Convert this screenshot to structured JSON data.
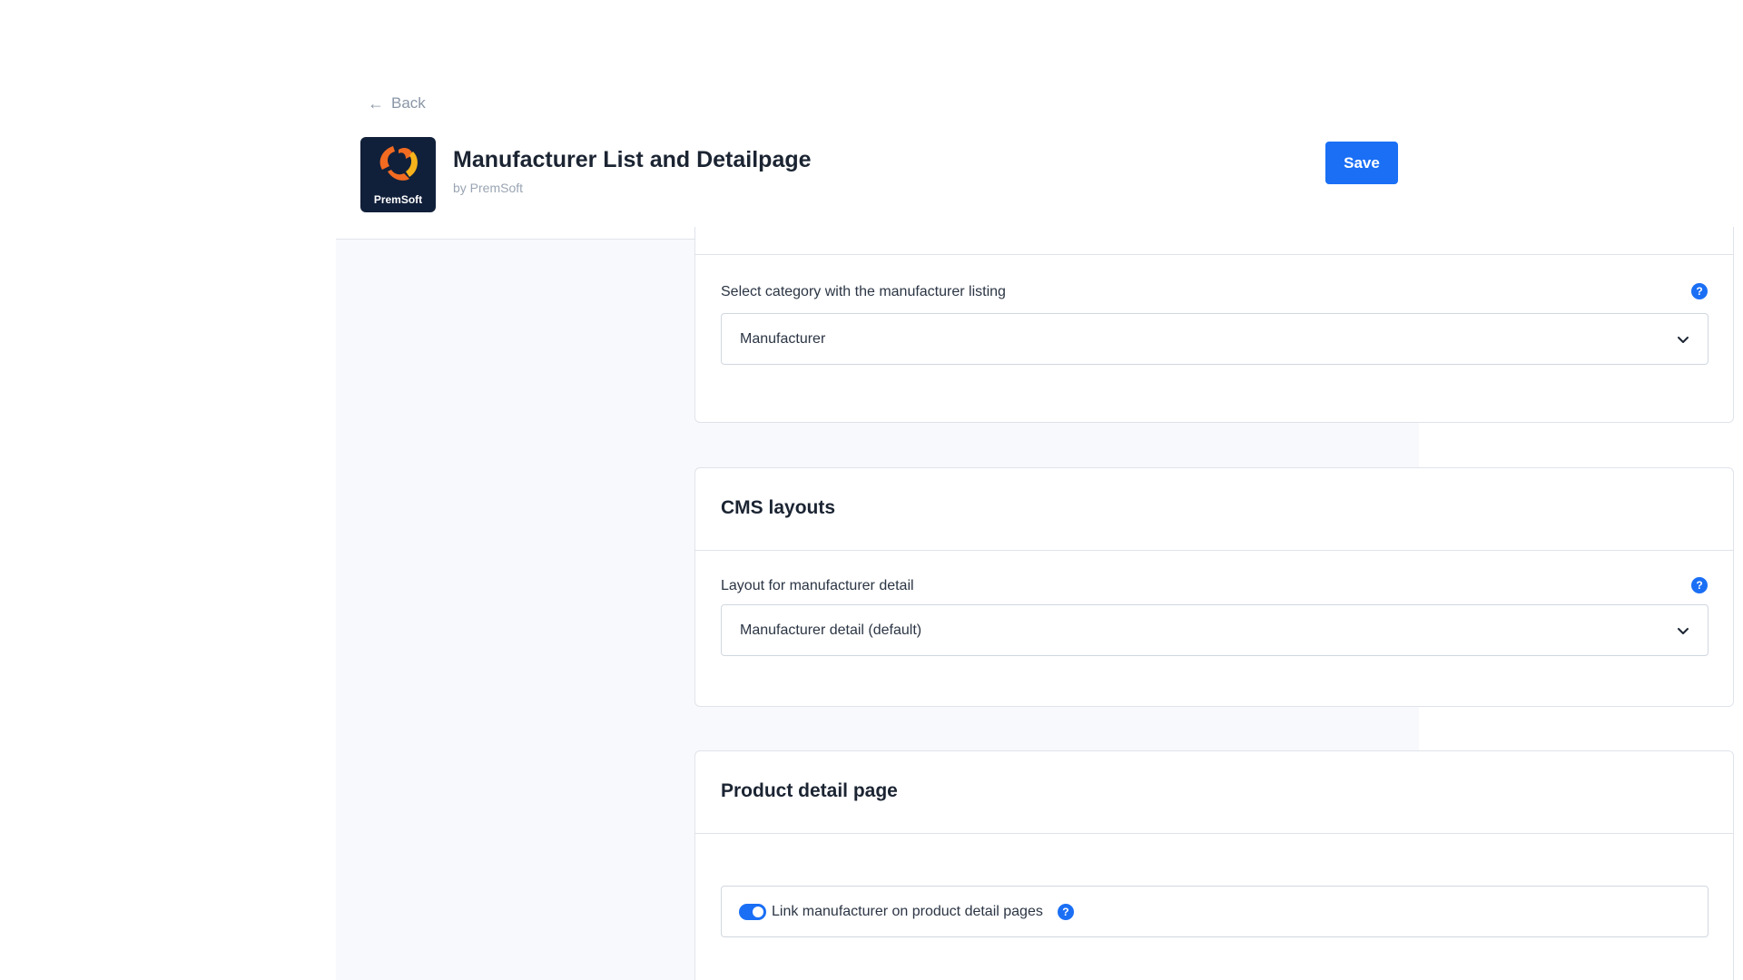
{
  "header": {
    "back_label": "Back",
    "app_title": "Manufacturer List and Detailpage",
    "app_vendor": "by PremSoft",
    "logo_text": "PremSoft",
    "save_label": "Save"
  },
  "sections": {
    "listing": {
      "field_label": "Select category with the manufacturer listing",
      "selected_value": "Manufacturer"
    },
    "cms_layouts": {
      "title": "CMS layouts",
      "field_label": "Layout for manufacturer detail",
      "selected_value": "Manufacturer detail (default)"
    },
    "product_detail": {
      "title": "Product detail page",
      "toggle_label": "Link manufacturer on product detail pages",
      "toggle_on": true
    }
  },
  "icons": {
    "back": "arrow-left-icon",
    "help": "question-circle-icon",
    "select": "chevron-down-icon"
  },
  "colors": {
    "accent": "#1a6ff5",
    "logo_bg": "#11203a",
    "logo_orange": "#f26b21",
    "logo_yellow": "#f7b21b",
    "content_bg": "#f8f9fc"
  }
}
